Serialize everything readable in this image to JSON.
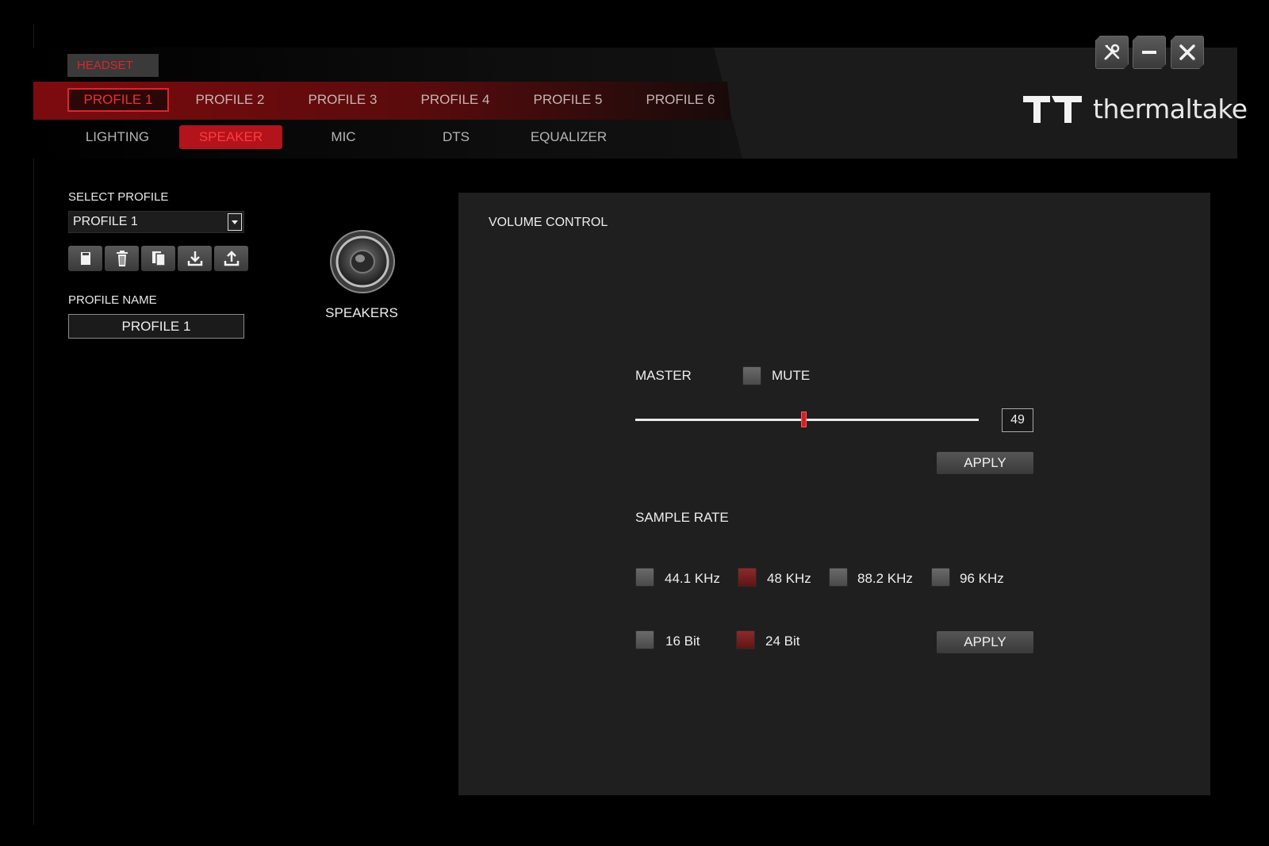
{
  "device_tab": "HEADSET",
  "profiles": [
    "PROFILE 1",
    "PROFILE 2",
    "PROFILE 3",
    "PROFILE 4",
    "PROFILE 5",
    "PROFILE 6"
  ],
  "active_profile_index": 0,
  "sub_tabs": [
    "LIGHTING",
    "SPEAKER",
    "MIC",
    "DTS",
    "EQUALIZER"
  ],
  "active_sub_tab_index": 1,
  "window_controls": {
    "settings_icon": "wrench-screwdriver-icon",
    "minimize_icon": "minimize-icon",
    "close_icon": "close-icon"
  },
  "brand": {
    "name": "thermaltake",
    "logo_icon": "tt-logo-icon"
  },
  "left": {
    "select_profile_label": "SELECT PROFILE",
    "select_profile_value": "PROFILE 1",
    "toolbar_icons": [
      "save-icon",
      "delete-icon",
      "copy-icon",
      "import-icon",
      "export-icon"
    ],
    "profile_name_label": "PROFILE NAME",
    "profile_name_value": "PROFILE 1"
  },
  "speaker": {
    "label": "SPEAKERS",
    "icon": "speaker-icon"
  },
  "volume_panel": {
    "title": "VOLUME CONTROL",
    "master_label": "MASTER",
    "mute_label": "MUTE",
    "mute_checked": false,
    "master_value": "49",
    "slider_fraction": 0.49,
    "apply_label": "APPLY",
    "sample_rate_label": "SAMPLE RATE",
    "sample_rates": [
      {
        "label": "44.1 KHz",
        "checked": false
      },
      {
        "label": "48 KHz",
        "checked": true
      },
      {
        "label": "88.2 KHz",
        "checked": false
      },
      {
        "label": "96 KHz",
        "checked": false
      }
    ],
    "bit_depths": [
      {
        "label": "16 Bit",
        "checked": false
      },
      {
        "label": "24 Bit",
        "checked": true
      }
    ],
    "apply2_label": "APPLY"
  },
  "colors": {
    "accent": "#d9262b",
    "panel": "#1f1f1f",
    "checked": "#7a1f1f"
  }
}
